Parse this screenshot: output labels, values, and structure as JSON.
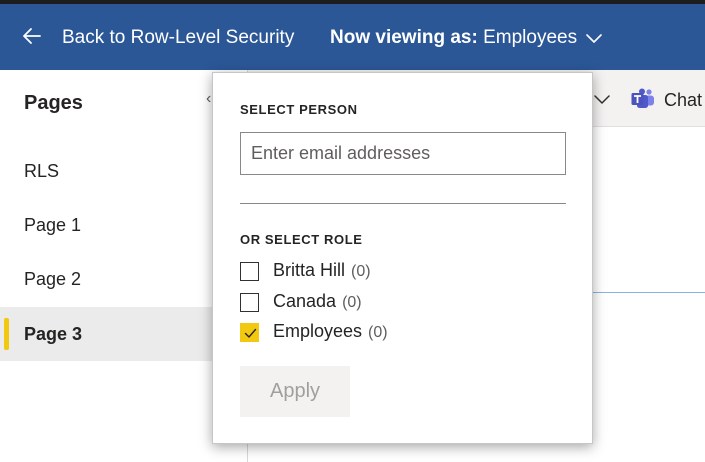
{
  "header": {
    "back_label": "Back to Row-Level Security",
    "viewing_label": "Now viewing as:",
    "viewing_value": "Employees",
    "back_icon": "arrow-left-icon",
    "dropdown_icon": "chevron-down-icon",
    "background_color": "#2b5797"
  },
  "sidebar": {
    "title": "Pages",
    "items": [
      {
        "label": "RLS",
        "active": false
      },
      {
        "label": "Page 1",
        "active": false
      },
      {
        "label": "Page 2",
        "active": false
      },
      {
        "label": "Page 3",
        "active": true
      }
    ],
    "accent_color": "#f2c811"
  },
  "toolbar": {
    "chat_label": "Chat",
    "teams_icon": "teams-icon"
  },
  "popover": {
    "person_heading": "SELECT PERSON",
    "email_placeholder": "Enter email addresses",
    "email_value": "",
    "role_heading": "OR SELECT ROLE",
    "roles": [
      {
        "name": "Britta Hill",
        "count": "(0)",
        "checked": false
      },
      {
        "name": "Canada",
        "count": "(0)",
        "checked": false
      },
      {
        "name": "Employees",
        "count": "(0)",
        "checked": true
      }
    ],
    "apply_label": "Apply",
    "apply_enabled": false
  }
}
